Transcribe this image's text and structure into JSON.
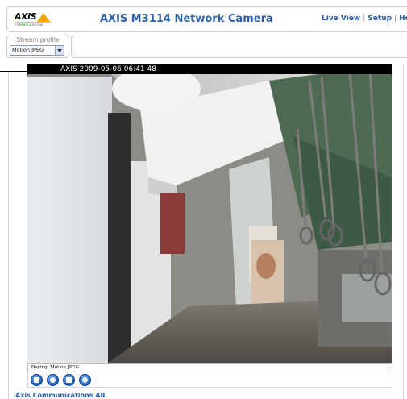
{
  "header": {
    "title": "AXIS M3114 Network Camera",
    "nav": {
      "live_view": "Live View",
      "separator": "|",
      "setup": "Setup",
      "help": "Help"
    },
    "logo": {
      "word": "AXIS",
      "sub": "COMMUNICATIONS"
    }
  },
  "stream_profile": {
    "label": "Stream profile",
    "selected": "Motion JPEG"
  },
  "video": {
    "overlay": "AXIS  2009-05-06 06:41  48"
  },
  "status": {
    "text": "Playing, Motion JPEG"
  },
  "controls": [
    {
      "icon": "stop-icon"
    },
    {
      "icon": "snapshot-icon"
    },
    {
      "icon": "record-icon"
    },
    {
      "icon": "audio-icon"
    }
  ],
  "footer": {
    "company": "Axis Communications AB"
  },
  "colors": {
    "link": "#2b5ea7",
    "logo_accent": "#f5a400"
  }
}
